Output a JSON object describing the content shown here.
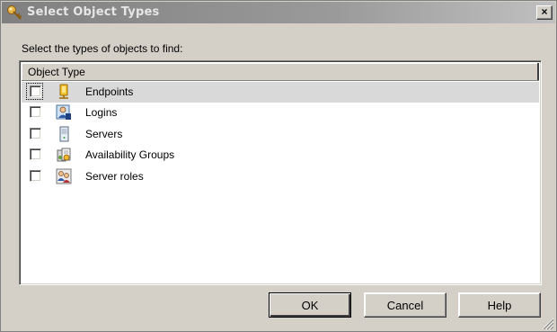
{
  "window": {
    "title": "Select Object Types",
    "close_label": "×"
  },
  "prompt": "Select the types of objects to find:",
  "list": {
    "header": "Object Type",
    "items": [
      {
        "label": "Endpoints",
        "checked": false,
        "selected": true,
        "icon": "endpoint-icon"
      },
      {
        "label": "Logins",
        "checked": false,
        "selected": false,
        "icon": "login-icon"
      },
      {
        "label": "Servers",
        "checked": false,
        "selected": false,
        "icon": "server-icon"
      },
      {
        "label": "Availability Groups",
        "checked": false,
        "selected": false,
        "icon": "availability-group-icon"
      },
      {
        "label": "Server roles",
        "checked": false,
        "selected": false,
        "icon": "server-role-icon"
      }
    ]
  },
  "buttons": {
    "ok": "OK",
    "cancel": "Cancel",
    "help": "Help"
  }
}
